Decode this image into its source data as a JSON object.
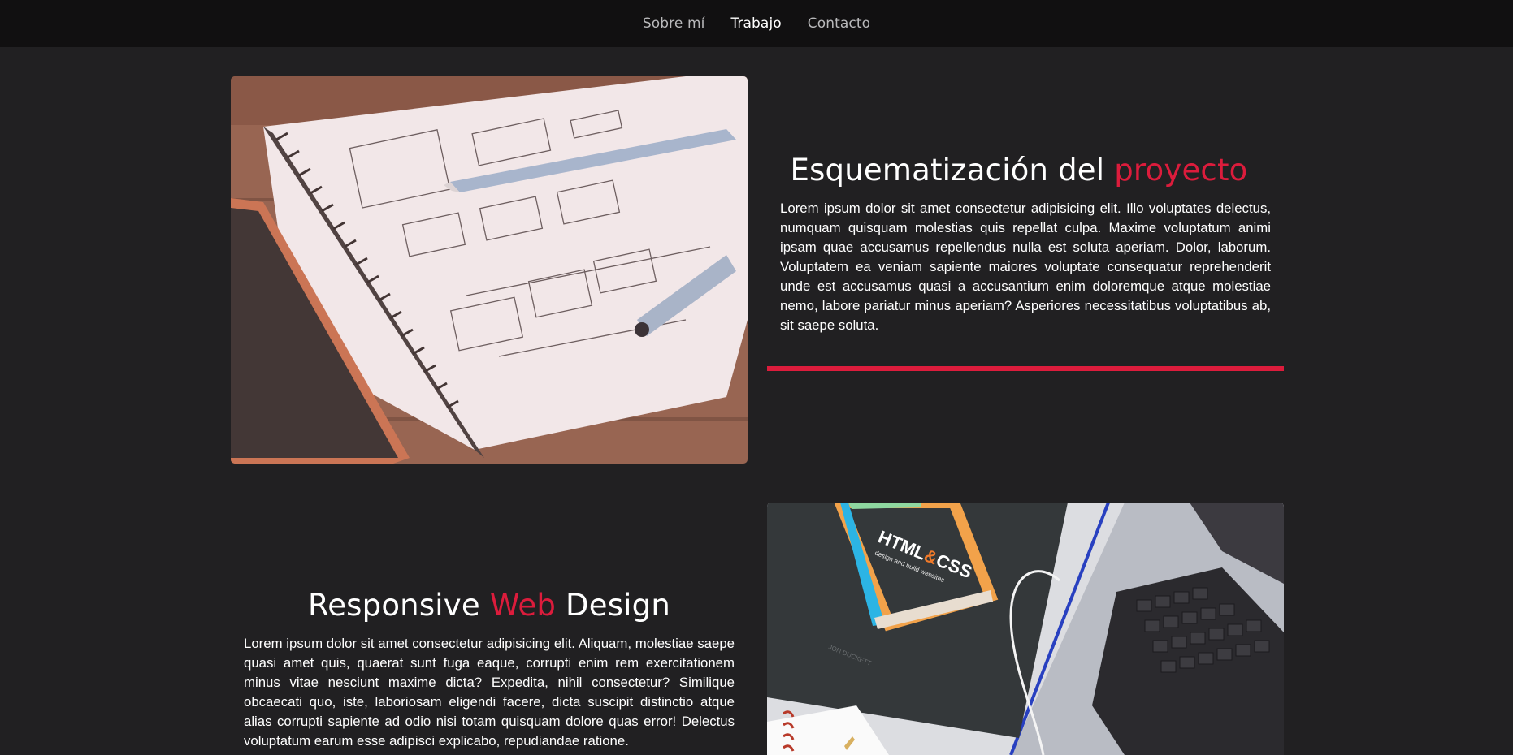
{
  "nav": {
    "items": [
      {
        "label": "Sobre mí"
      },
      {
        "label": "Trabajo"
      },
      {
        "label": "Contacto"
      }
    ],
    "active_index": 1
  },
  "sections": [
    {
      "title_start": "Esquematización del ",
      "title_accent": "proyecto",
      "title_end": "",
      "body": "Lorem ipsum dolor sit amet consectetur adipisicing elit. Illo voluptates delectus, numquam quisquam molestias quis repellat culpa. Maxime voluptatum animi ipsam quae accusamus repellendus nulla est soluta aperiam. Dolor, laborum. Voluptatem ea veniam sapiente maiores voluptate consequatur reprehenderit unde est accusamus quasi a accusantium enim doloremque atque molestiae nemo, labore pariatur minus aperiam? Asperiores necessitatibus voluptatibus ab, sit saepe soluta.",
      "image": "wireframe-sketch-photo"
    },
    {
      "title_start": "Responsive ",
      "title_accent": "Web",
      "title_end": " Design",
      "body": "Lorem ipsum dolor sit amet consectetur adipisicing elit. Aliquam, molestiae saepe quasi amet quis, quaerat sunt fuga eaque, corrupti enim rem exercitationem minus vitae nesciunt maxime dicta? Expedita, nihil consectetur? Similique obcaecati quo, iste, laboriosam eligendi facere, dicta suscipit distinctio atque alias corrupti sapiente ad odio nisi totam quisquam dolore quas error! Delectus voluptatum earum esse adipisci explicabo, repudiandae ratione.",
      "image": "html-css-book-laptop-photo",
      "image_text": {
        "book_title_a": "HTML",
        "book_title_amp": "&",
        "book_title_b": "CSS",
        "book_subtitle": "design and build websites",
        "book_author": "JON DUCKETT"
      }
    }
  ],
  "colors": {
    "accent": "#dc1c3c",
    "background": "#212022",
    "navbar": "#111011"
  }
}
